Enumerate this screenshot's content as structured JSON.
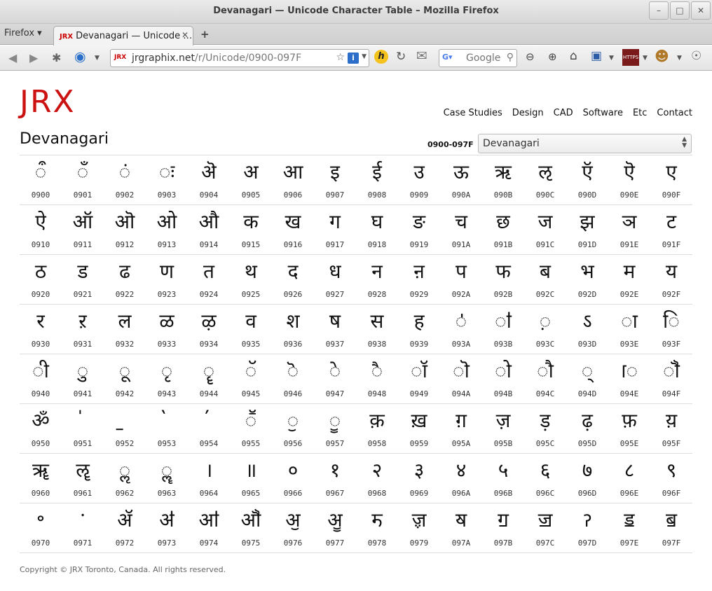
{
  "window": {
    "title": "Devanagari — Unicode Character Table – Mozilla Firefox",
    "controls": [
      "–",
      "□",
      "✕"
    ]
  },
  "tabs": {
    "menu_label": "Firefox ▾",
    "active_tab": "Devanagari — Unicode …",
    "favicon_text": "JRX",
    "new_tab": "+"
  },
  "navbar": {
    "url_host": "jrgraphix.net",
    "url_path": "/r/Unicode/0900-097F",
    "url_favicon": "JRX",
    "search_placeholder": "Google"
  },
  "site": {
    "logo": "JRX",
    "nav": [
      "Case Studies",
      "Design",
      "CAD",
      "Software",
      "Etc",
      "Contact"
    ],
    "page_title": "Devanagari",
    "range_label": "0900-097F",
    "select_value": "Devanagari",
    "footer": "Copyright © JRX Toronto, Canada. All rights reserved."
  },
  "table": {
    "rows": [
      [
        [
          "ऀ",
          "0900"
        ],
        [
          "ँ",
          "0901"
        ],
        [
          "ं",
          "0902"
        ],
        [
          "ः",
          "0903"
        ],
        [
          "ऄ",
          "0904"
        ],
        [
          "अ",
          "0905"
        ],
        [
          "आ",
          "0906"
        ],
        [
          "इ",
          "0907"
        ],
        [
          "ई",
          "0908"
        ],
        [
          "उ",
          "0909"
        ],
        [
          "ऊ",
          "090A"
        ],
        [
          "ऋ",
          "090B"
        ],
        [
          "ऌ",
          "090C"
        ],
        [
          "ऍ",
          "090D"
        ],
        [
          "ऎ",
          "090E"
        ],
        [
          "ए",
          "090F"
        ]
      ],
      [
        [
          "ऐ",
          "0910"
        ],
        [
          "ऑ",
          "0911"
        ],
        [
          "ऒ",
          "0912"
        ],
        [
          "ओ",
          "0913"
        ],
        [
          "औ",
          "0914"
        ],
        [
          "क",
          "0915"
        ],
        [
          "ख",
          "0916"
        ],
        [
          "ग",
          "0917"
        ],
        [
          "घ",
          "0918"
        ],
        [
          "ङ",
          "0919"
        ],
        [
          "च",
          "091A"
        ],
        [
          "छ",
          "091B"
        ],
        [
          "ज",
          "091C"
        ],
        [
          "झ",
          "091D"
        ],
        [
          "ञ",
          "091E"
        ],
        [
          "ट",
          "091F"
        ]
      ],
      [
        [
          "ठ",
          "0920"
        ],
        [
          "ड",
          "0921"
        ],
        [
          "ढ",
          "0922"
        ],
        [
          "ण",
          "0923"
        ],
        [
          "त",
          "0924"
        ],
        [
          "थ",
          "0925"
        ],
        [
          "द",
          "0926"
        ],
        [
          "ध",
          "0927"
        ],
        [
          "न",
          "0928"
        ],
        [
          "ऩ",
          "0929"
        ],
        [
          "प",
          "092A"
        ],
        [
          "फ",
          "092B"
        ],
        [
          "ब",
          "092C"
        ],
        [
          "भ",
          "092D"
        ],
        [
          "म",
          "092E"
        ],
        [
          "य",
          "092F"
        ]
      ],
      [
        [
          "र",
          "0930"
        ],
        [
          "ऱ",
          "0931"
        ],
        [
          "ल",
          "0932"
        ],
        [
          "ळ",
          "0933"
        ],
        [
          "ऴ",
          "0934"
        ],
        [
          "व",
          "0935"
        ],
        [
          "श",
          "0936"
        ],
        [
          "ष",
          "0937"
        ],
        [
          "स",
          "0938"
        ],
        [
          "ह",
          "0939"
        ],
        [
          "ऺ",
          "093A"
        ],
        [
          "ऻ",
          "093B"
        ],
        [
          "़",
          "093C"
        ],
        [
          "ऽ",
          "093D"
        ],
        [
          "ा",
          "093E"
        ],
        [
          "ि",
          "093F"
        ]
      ],
      [
        [
          "ी",
          "0940"
        ],
        [
          "ु",
          "0941"
        ],
        [
          "ू",
          "0942"
        ],
        [
          "ृ",
          "0943"
        ],
        [
          "ॄ",
          "0944"
        ],
        [
          "ॅ",
          "0945"
        ],
        [
          "ॆ",
          "0946"
        ],
        [
          "े",
          "0947"
        ],
        [
          "ै",
          "0948"
        ],
        [
          "ॉ",
          "0949"
        ],
        [
          "ॊ",
          "094A"
        ],
        [
          "ो",
          "094B"
        ],
        [
          "ौ",
          "094C"
        ],
        [
          "्",
          "094D"
        ],
        [
          "ॎ",
          "094E"
        ],
        [
          "ॏ",
          "094F"
        ]
      ],
      [
        [
          "ॐ",
          "0950"
        ],
        [
          "॑",
          "0951"
        ],
        [
          "॒",
          "0952"
        ],
        [
          "॓",
          "0953"
        ],
        [
          "॔",
          "0954"
        ],
        [
          "ॕ",
          "0955"
        ],
        [
          "ॖ",
          "0956"
        ],
        [
          "ॗ",
          "0957"
        ],
        [
          "क़",
          "0958"
        ],
        [
          "ख़",
          "0959"
        ],
        [
          "ग़",
          "095A"
        ],
        [
          "ज़",
          "095B"
        ],
        [
          "ड़",
          "095C"
        ],
        [
          "ढ़",
          "095D"
        ],
        [
          "फ़",
          "095E"
        ],
        [
          "य़",
          "095F"
        ]
      ],
      [
        [
          "ॠ",
          "0960"
        ],
        [
          "ॡ",
          "0961"
        ],
        [
          "ॢ",
          "0962"
        ],
        [
          "ॣ",
          "0963"
        ],
        [
          "।",
          "0964"
        ],
        [
          "॥",
          "0965"
        ],
        [
          "०",
          "0966"
        ],
        [
          "१",
          "0967"
        ],
        [
          "२",
          "0968"
        ],
        [
          "३",
          "0969"
        ],
        [
          "४",
          "096A"
        ],
        [
          "५",
          "096B"
        ],
        [
          "६",
          "096C"
        ],
        [
          "७",
          "096D"
        ],
        [
          "८",
          "096E"
        ],
        [
          "९",
          "096F"
        ]
      ],
      [
        [
          "॰",
          "0970"
        ],
        [
          "ॱ",
          "0971"
        ],
        [
          "ॲ",
          "0972"
        ],
        [
          "ॳ",
          "0973"
        ],
        [
          "ॴ",
          "0974"
        ],
        [
          "ॵ",
          "0975"
        ],
        [
          "ॶ",
          "0976"
        ],
        [
          "ॷ",
          "0977"
        ],
        [
          "ॸ",
          "0978"
        ],
        [
          "ॹ",
          "0979"
        ],
        [
          "ॺ",
          "097A"
        ],
        [
          "ॻ",
          "097B"
        ],
        [
          "ॼ",
          "097C"
        ],
        [
          "ॽ",
          "097D"
        ],
        [
          "ॾ",
          "097E"
        ],
        [
          "ॿ",
          "097F"
        ]
      ]
    ]
  }
}
